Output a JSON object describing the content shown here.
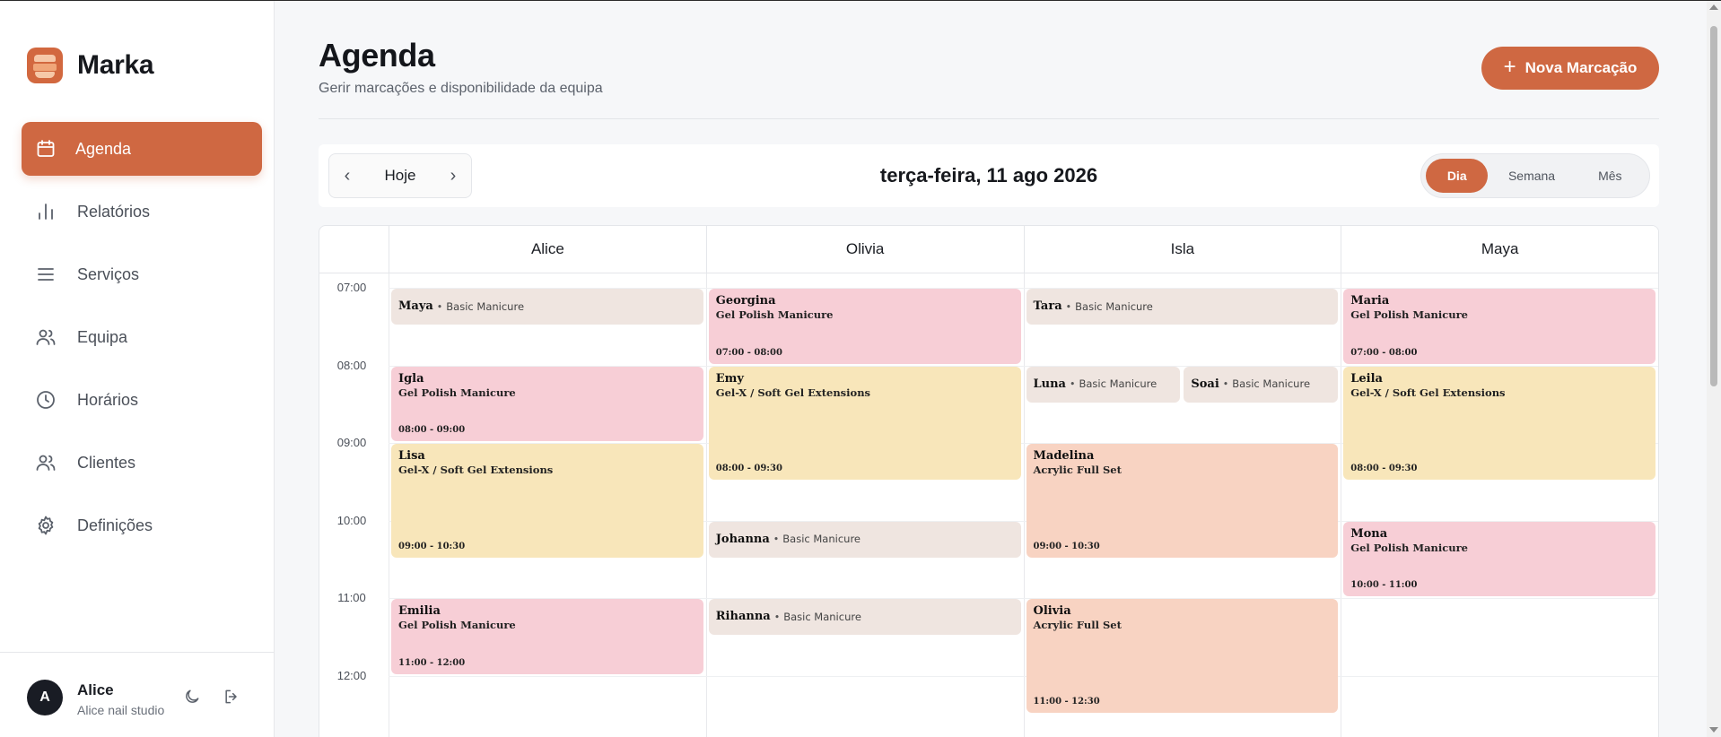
{
  "app": {
    "name": "Marka"
  },
  "colors": {
    "accent": "#cf6842",
    "gel": "#f7ced6",
    "basic": "#efe5e0",
    "extensions": "#f8e6ba",
    "acrylic": "#f8d3c2"
  },
  "sidebar": {
    "items": [
      {
        "label": "Agenda",
        "icon": "calendar-icon",
        "active": true
      },
      {
        "label": "Relatórios",
        "icon": "bar-chart-icon",
        "active": false
      },
      {
        "label": "Serviços",
        "icon": "list-icon",
        "active": false
      },
      {
        "label": "Equipa",
        "icon": "users-icon",
        "active": false
      },
      {
        "label": "Horários",
        "icon": "clock-icon",
        "active": false
      },
      {
        "label": "Clientes",
        "icon": "users-icon",
        "active": false
      },
      {
        "label": "Definições",
        "icon": "gear-icon",
        "active": false
      }
    ],
    "user": {
      "initial": "A",
      "name": "Alice",
      "studio": "Alice nail studio"
    }
  },
  "header": {
    "title": "Agenda",
    "subtitle": "Gerir marcações e disponibilidade da equipa",
    "new_button": "Nova Marcação"
  },
  "toolbar": {
    "today": "Hoje",
    "date": "terça-feira, 11 ago 2026",
    "views": [
      {
        "label": "Dia",
        "active": true
      },
      {
        "label": "Semana",
        "active": false
      },
      {
        "label": "Mês",
        "active": false
      }
    ]
  },
  "calendar": {
    "staff": [
      "Alice",
      "Olivia",
      "Isla",
      "Maya"
    ],
    "hours": [
      "07:00",
      "08:00",
      "09:00",
      "10:00",
      "11:00",
      "12:00"
    ],
    "events": [
      {
        "staff": 0,
        "start": 7.0,
        "end": 7.5,
        "client": "Maya",
        "service": "Basic Manicure",
        "kind": "basic",
        "short": true
      },
      {
        "staff": 0,
        "start": 8.0,
        "end": 9.0,
        "client": "Igla",
        "service": "Gel Polish Manicure",
        "time": "08:00 - 09:00",
        "kind": "gel"
      },
      {
        "staff": 0,
        "start": 9.0,
        "end": 10.5,
        "client": "Lisa",
        "service": "Gel-X / Soft Gel Extensions",
        "time": "09:00 - 10:30",
        "kind": "ext"
      },
      {
        "staff": 0,
        "start": 11.0,
        "end": 12.0,
        "client": "Emilia",
        "service": "Gel Polish Manicure",
        "time": "11:00 - 12:00",
        "kind": "gel"
      },
      {
        "staff": 1,
        "start": 7.0,
        "end": 8.0,
        "client": "Georgina",
        "service": "Gel Polish Manicure",
        "time": "07:00 - 08:00",
        "kind": "gel"
      },
      {
        "staff": 1,
        "start": 8.0,
        "end": 9.5,
        "client": "Emy",
        "service": "Gel-X / Soft Gel Extensions",
        "time": "08:00 - 09:30",
        "kind": "ext"
      },
      {
        "staff": 1,
        "start": 10.0,
        "end": 10.5,
        "client": "Johanna",
        "service": "Basic Manicure",
        "kind": "basic",
        "short": true
      },
      {
        "staff": 1,
        "start": 11.0,
        "end": 11.5,
        "client": "Rihanna",
        "service": "Basic Manicure",
        "kind": "basic",
        "short": true
      },
      {
        "staff": 2,
        "start": 7.0,
        "end": 7.5,
        "client": "Tara",
        "service": "Basic Manicure",
        "kind": "basic",
        "short": true
      },
      {
        "staff": 2,
        "start": 8.0,
        "end": 8.5,
        "client": "Luna",
        "service": "Basic Manicure",
        "kind": "basic",
        "short": true,
        "lane": 0,
        "lanes": 2
      },
      {
        "staff": 2,
        "start": 8.0,
        "end": 8.5,
        "client": "Soai",
        "service": "Basic Manicure",
        "kind": "basic",
        "short": true,
        "lane": 1,
        "lanes": 2
      },
      {
        "staff": 2,
        "start": 9.0,
        "end": 10.5,
        "client": "Madelina",
        "service": "Acrylic Full Set",
        "time": "09:00 - 10:30",
        "kind": "acr"
      },
      {
        "staff": 2,
        "start": 11.0,
        "end": 12.5,
        "client": "Olivia",
        "service": "Acrylic Full Set",
        "time": "11:00 - 12:30",
        "kind": "acr"
      },
      {
        "staff": 3,
        "start": 7.0,
        "end": 8.0,
        "client": "Maria",
        "service": "Gel Polish Manicure",
        "time": "07:00 - 08:00",
        "kind": "gel"
      },
      {
        "staff": 3,
        "start": 8.0,
        "end": 9.5,
        "client": "Leila",
        "service": "Gel-X / Soft Gel Extensions",
        "time": "08:00 - 09:30",
        "kind": "ext"
      },
      {
        "staff": 3,
        "start": 10.0,
        "end": 11.0,
        "client": "Mona",
        "service": "Gel Polish Manicure",
        "time": "10:00 - 11:00",
        "kind": "gel"
      }
    ]
  }
}
